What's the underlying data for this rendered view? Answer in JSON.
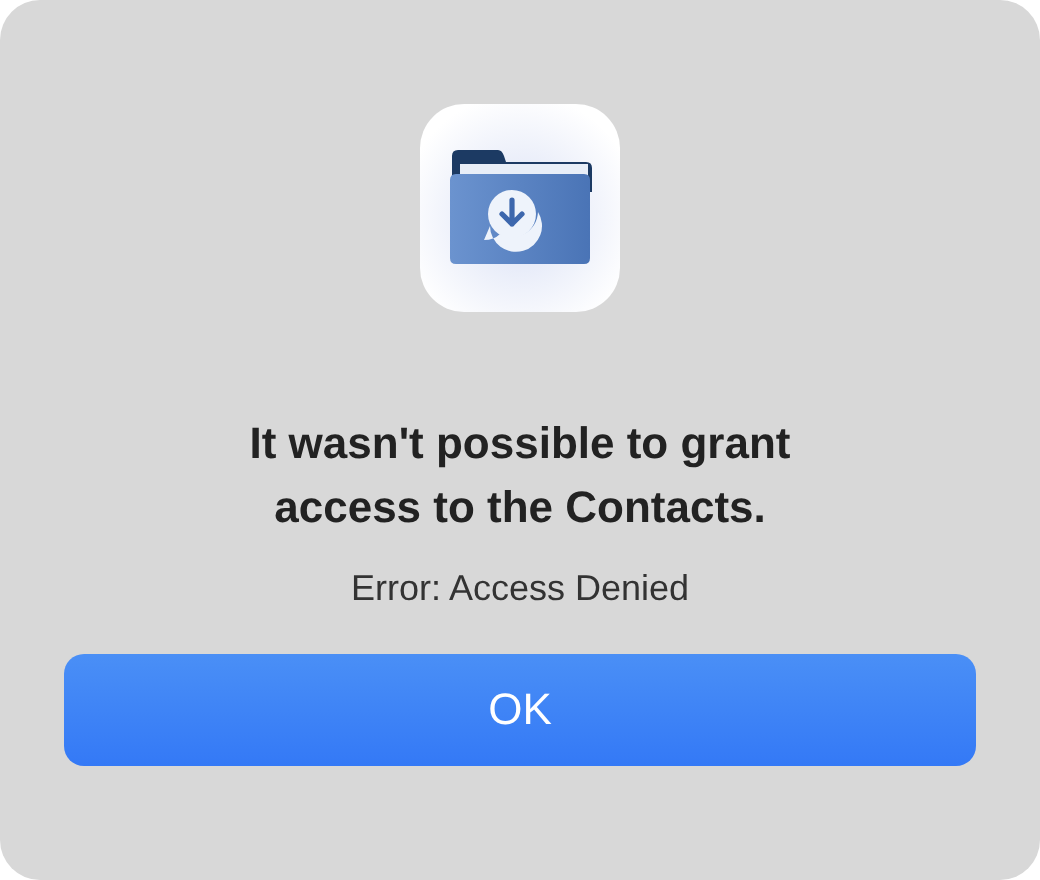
{
  "alert": {
    "title": "It wasn't possible to grant access to the Contacts.",
    "message": "Error: Access Denied",
    "buttons": [
      {
        "label": "OK",
        "default": true
      }
    ]
  }
}
